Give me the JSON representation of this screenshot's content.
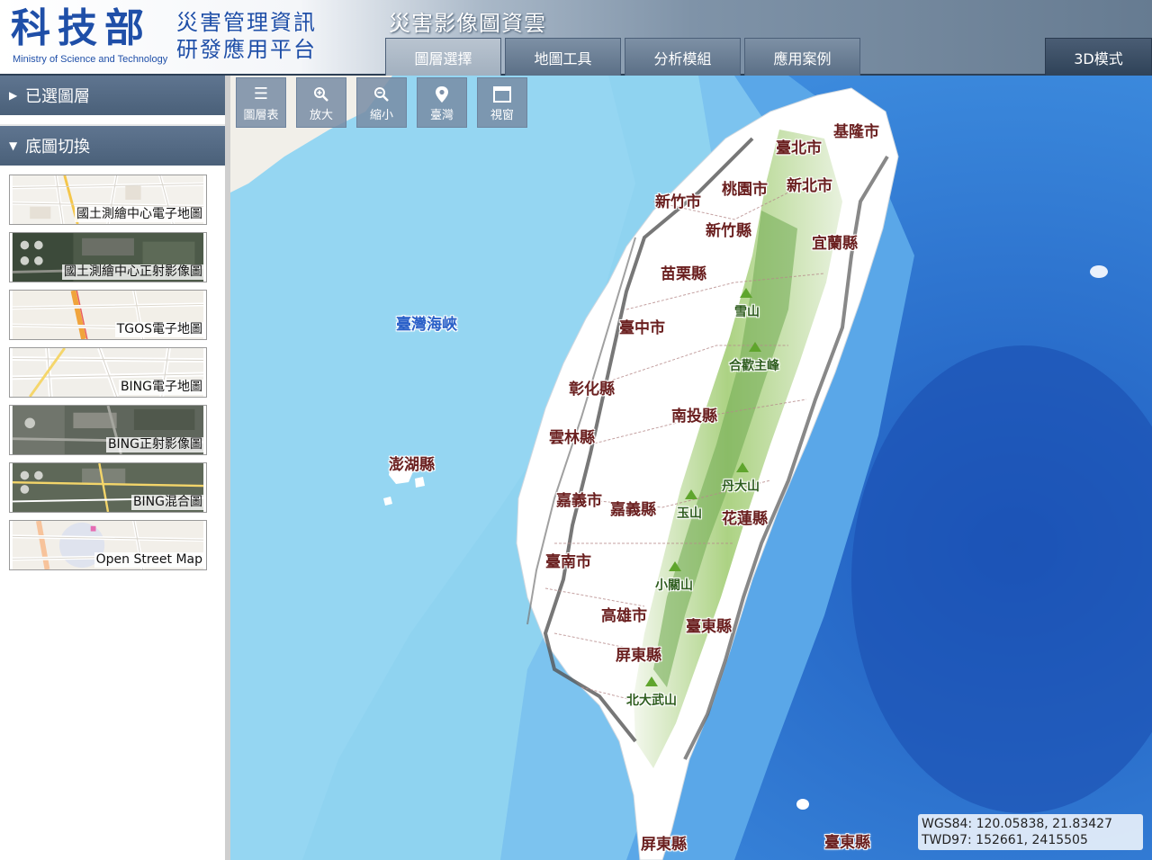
{
  "header": {
    "logo_cn": "科技部",
    "logo_en": "Ministry of Science and Technology",
    "platform_name_line1": "災害管理資訊",
    "platform_name_line2": "研發應用平台",
    "app_title": "災害影像圖資雲"
  },
  "tabs": [
    {
      "label": "圖層選擇",
      "active": true
    },
    {
      "label": "地圖工具",
      "active": false
    },
    {
      "label": "分析模組",
      "active": false
    },
    {
      "label": "應用案例",
      "active": false
    }
  ],
  "mode_3d_label": "3D模式",
  "sidebar": {
    "selected_layers_label": "已選圖層",
    "basemap_label": "底圖切換",
    "basemaps": [
      {
        "label": "國土測繪中心電子地圖",
        "style": "vector"
      },
      {
        "label": "國土測繪中心正射影像圖",
        "style": "satellite"
      },
      {
        "label": "TGOS電子地圖",
        "style": "tgos"
      },
      {
        "label": "BING電子地圖",
        "style": "bingroad"
      },
      {
        "label": "BING正射影像圖",
        "style": "satellite"
      },
      {
        "label": "BING混合圖",
        "style": "hybrid"
      },
      {
        "label": "Open Street Map",
        "style": "osm"
      }
    ]
  },
  "map_tools": [
    {
      "label": "圖層表",
      "icon": "layers-icon"
    },
    {
      "label": "放大",
      "icon": "zoom-in-icon"
    },
    {
      "label": "縮小",
      "icon": "zoom-out-icon"
    },
    {
      "label": "臺灣",
      "icon": "location-pin-icon"
    },
    {
      "label": "視窗",
      "icon": "window-icon"
    }
  ],
  "map_labels": {
    "sea": [
      "臺灣海峽",
      "澎湖縣"
    ],
    "places": [
      "基隆市",
      "臺北市",
      "新北市",
      "桃園市",
      "新竹市",
      "新竹縣",
      "宜蘭縣",
      "苗栗縣",
      "臺中市",
      "彰化縣",
      "南投縣",
      "雲林縣",
      "嘉義市",
      "嘉義縣",
      "花蓮縣",
      "臺南市",
      "高雄市",
      "臺東縣",
      "屏東縣",
      "屏東縣",
      "臺東縣"
    ],
    "mountains": [
      "雪山",
      "合歡主峰",
      "丹大山",
      "玉山",
      "小關山",
      "北大武山"
    ]
  },
  "coordinates": {
    "wgs84_label": "WGS84:",
    "wgs84_value": "120.05838, 21.83427",
    "twd97_label": "TWD97:",
    "twd97_value": "152661, 2415505"
  },
  "colors": {
    "header_blue": "#1f4fa8",
    "panel_head": "#5f7590",
    "deep_sea": "#2e7fd6",
    "shallow_sea": "#8fd3f0",
    "land": "#ffffff",
    "mountain_green": "#5fa52d"
  }
}
